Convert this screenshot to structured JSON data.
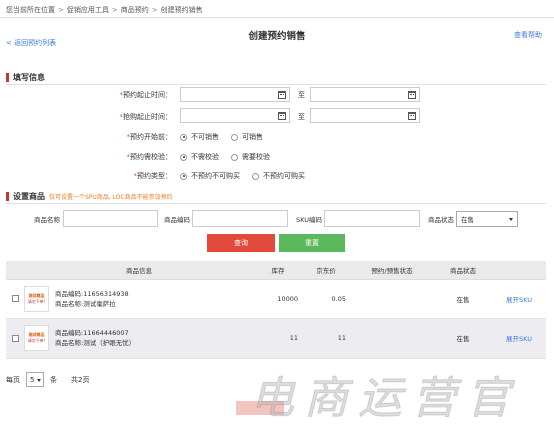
{
  "breadcrumb": [
    "您当前所在位置",
    "促销应用工具",
    "商品预约",
    "创建预约销售"
  ],
  "header": {
    "title": "创建预约销售",
    "back_label": "< 返回预约列表",
    "help_label": "查看帮助"
  },
  "form_section": {
    "title": "填写信息",
    "appointment_period_label": "预约起止时间：",
    "purchase_period_label": "抢购起止时间：",
    "to_label": "至",
    "before_appointment": {
      "label": "预约开始前：",
      "options": [
        "不可销售",
        "可销售"
      ],
      "selected": 0
    },
    "verify": {
      "label": "预约需校验：",
      "options": [
        "不需校验",
        "需要校验"
      ],
      "selected": 0
    },
    "type": {
      "label": "预约类型：",
      "options": [
        "不预约不可购买",
        "不预约可购买"
      ],
      "selected": 0
    }
  },
  "goods_section": {
    "title": "设置商品",
    "hint": "仅可设置一个SPU商品, LOC商品不能参加预约",
    "filters": {
      "name_label": "商品名称",
      "code_label": "商品编码",
      "sku_label": "SKU编码",
      "status_label": "商品状态",
      "status_value": "在售"
    },
    "query_label": "查询",
    "reset_label": "重置"
  },
  "table": {
    "headers": [
      "商品信息",
      "库存",
      "京东价",
      "预约/预售状态",
      "商品状态",
      ""
    ],
    "rows": [
      {
        "thumb_line1": "测试商品",
        "thumb_line2": "请勿下单!",
        "code": "商品编码:11656314938",
        "name": "商品名称:测试毫萨拉",
        "stock": "10000",
        "price": "0.05",
        "appt_status": "",
        "goods_status": "在售",
        "action": "展开SKU"
      },
      {
        "thumb_line1": "测试商品",
        "thumb_line2": "请勿下单!",
        "code": "商品编码:11664446007",
        "name": "商品名称:测试（护眼无忧）",
        "stock": "11",
        "price": "11",
        "appt_status": "",
        "goods_status": "在售",
        "action": "展开SKU"
      }
    ]
  },
  "pager": {
    "per_page_label": "每页",
    "per_page_value": "5",
    "unit": "条",
    "total": "共2页"
  },
  "watermark": "电商运营官"
}
